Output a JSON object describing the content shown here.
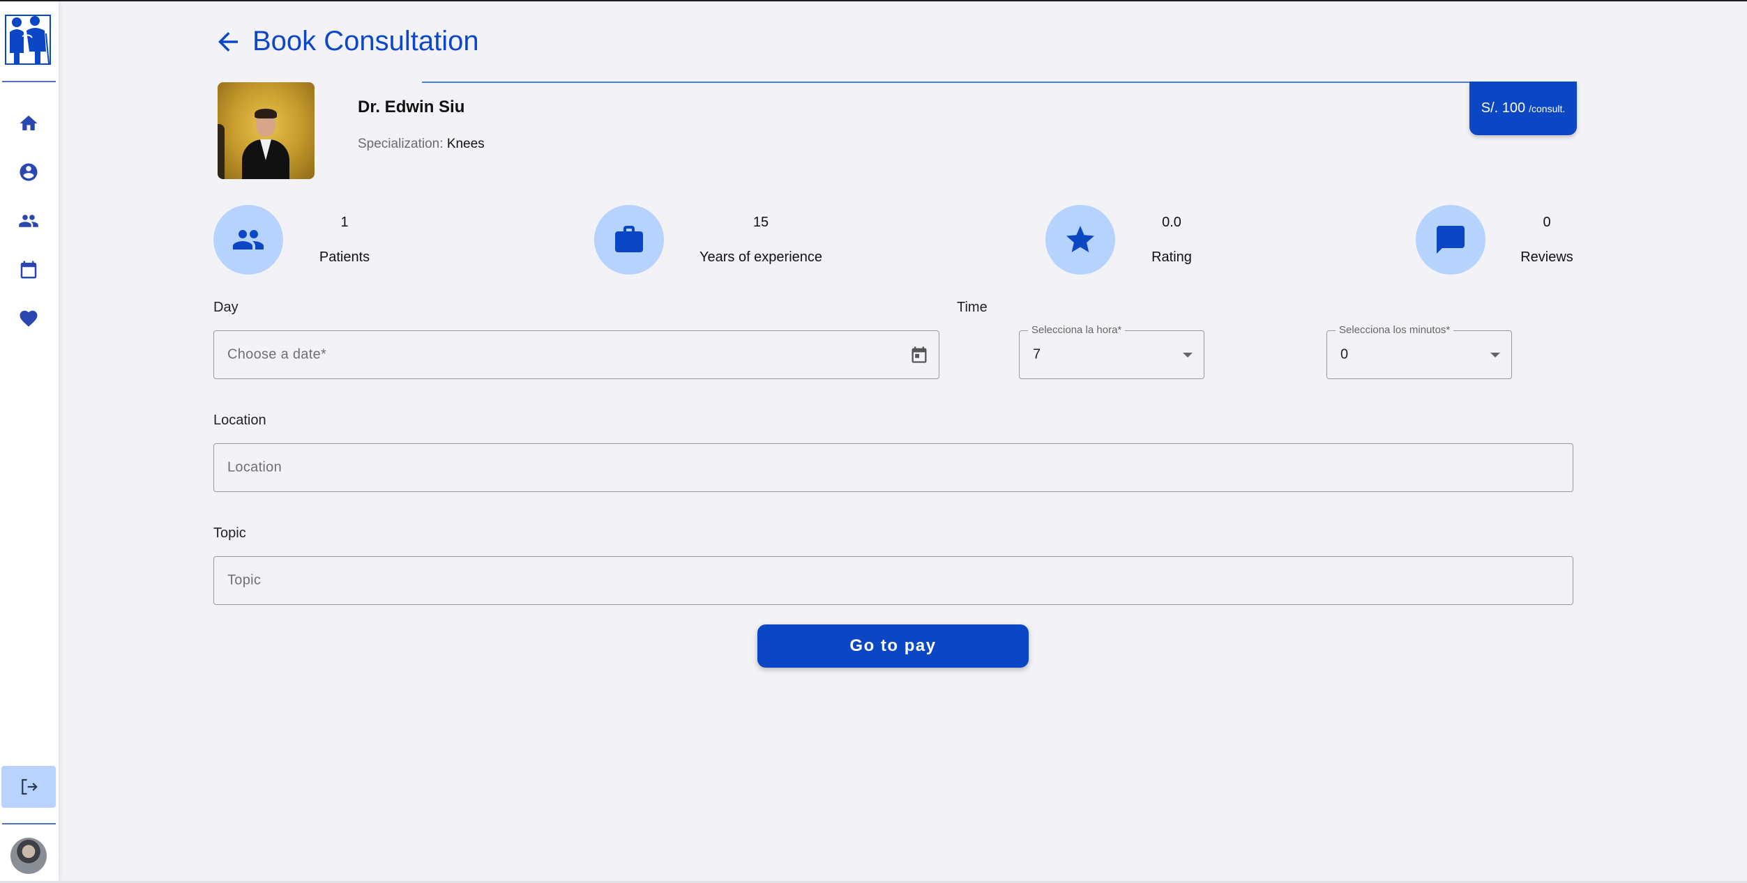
{
  "colors": {
    "primary": "#0b47c5",
    "accent_light": "#b6d2ff",
    "nav_icon": "#2a47b1",
    "background": "#f3f3f7"
  },
  "sidebar": {
    "items": [
      {
        "icon": "home-icon"
      },
      {
        "icon": "account-circle-icon"
      },
      {
        "icon": "people-icon"
      },
      {
        "icon": "calendar-icon"
      },
      {
        "icon": "heart-icon"
      }
    ],
    "logout_icon": "logout-icon"
  },
  "header": {
    "title": "Book Consultation",
    "back_icon": "arrow-back-icon"
  },
  "doctor": {
    "name": "Dr. Edwin Siu",
    "specialization_label": "Specialization:",
    "specialization": "Knees",
    "price": "S/. 100",
    "price_unit": "/consult."
  },
  "stats": [
    {
      "icon": "people-icon",
      "value": "1",
      "label": "Patients"
    },
    {
      "icon": "briefcase-icon",
      "value": "15",
      "label": "Years of experience"
    },
    {
      "icon": "star-icon",
      "value": "0.0",
      "label": "Rating"
    },
    {
      "icon": "chat-icon",
      "value": "0",
      "label": "Reviews"
    }
  ],
  "form": {
    "day_label": "Day",
    "date_placeholder": "Choose a date*",
    "time_label": "Time",
    "hour_label": "Selecciona la hora*",
    "hour_value": "7",
    "minutes_label": "Selecciona los minutos*",
    "minutes_value": "0",
    "location_label": "Location",
    "location_placeholder": "Location",
    "topic_label": "Topic",
    "topic_placeholder": "Topic",
    "submit_label": "Go to pay"
  }
}
